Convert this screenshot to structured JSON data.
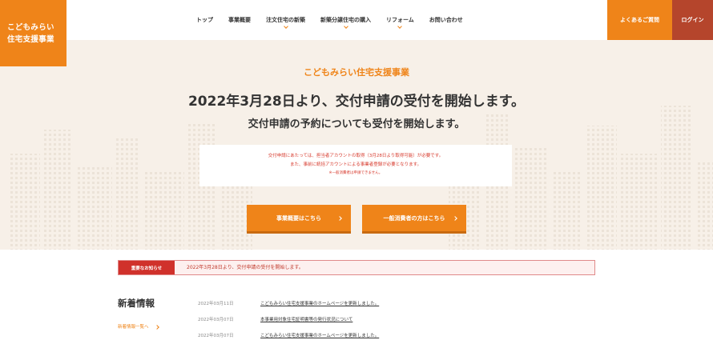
{
  "logo": {
    "line1": "こどもみらい",
    "line2": "住宅支援事業"
  },
  "nav": [
    {
      "label": "トップ",
      "has_dropdown": false
    },
    {
      "label": "事業概要",
      "has_dropdown": false
    },
    {
      "label": "注文住宅の新築",
      "has_dropdown": true
    },
    {
      "label": "新築分譲住宅の購入",
      "has_dropdown": true
    },
    {
      "label": "リフォーム",
      "has_dropdown": true
    },
    {
      "label": "お問い合わせ",
      "has_dropdown": false
    }
  ],
  "header_buttons": {
    "faq": "よくあるご質問",
    "login": "ログイン"
  },
  "hero": {
    "subtitle": "こどもみらい住宅支援事業",
    "title": "2022年3月28日より、交付申請の受付を開始します。",
    "title2": "交付申請の予約についても受付を開始します。",
    "notice_line1": "交付申請にあたっては、担当者アカウントの取得（3月28日より取得可能）が必要です。",
    "notice_line2": "また、事前に統括アカウントによる事業者登録が必要となります。",
    "notice_line3": "※一般消費者は申請できません。",
    "button1": "事業概要はこちら",
    "button2": "一般消費者の方はこちら"
  },
  "important": {
    "tag": "重要なお知らせ",
    "message": "2022年3月28日より、交付申請の受付を開始します。"
  },
  "news": {
    "title": "新着情報",
    "all_link": "新着情報一覧へ",
    "items": [
      {
        "date": "2022年03月11日",
        "text": "こどもみらい住宅支援事業のホームページを更新しました。"
      },
      {
        "date": "2022年03月07日",
        "text": "本事業用対象住宅証明書等の発行状況について"
      },
      {
        "date": "2022年03月07日",
        "text": "こどもみらい住宅支援事業のホームページを更新しました。"
      }
    ]
  },
  "colors": {
    "accent": "#ef8419",
    "login": "#b5452c",
    "alert": "#d0312b",
    "hero_bg": "#f7f0e8"
  }
}
